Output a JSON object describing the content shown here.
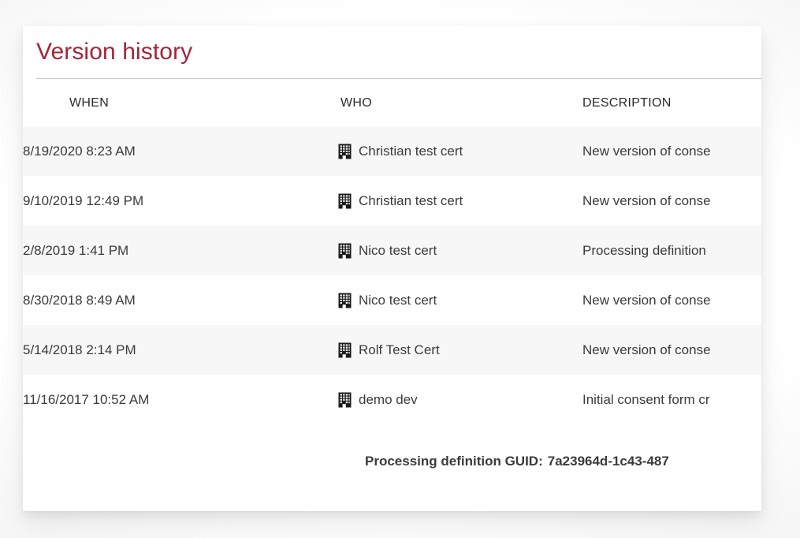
{
  "card": {
    "title": "Version history"
  },
  "table": {
    "columns": [
      {
        "key": "when",
        "label": "WHEN"
      },
      {
        "key": "who",
        "label": "WHO"
      },
      {
        "key": "description",
        "label": "DESCRIPTION"
      }
    ],
    "rows": [
      {
        "when": "8/19/2020 8:23 AM",
        "who": "Christian test cert",
        "who_icon": "building-icon",
        "description": "New version of conse"
      },
      {
        "when": "9/10/2019 12:49 PM",
        "who": "Christian test cert",
        "who_icon": "building-icon",
        "description": "New version of conse"
      },
      {
        "when": "2/8/2019 1:41 PM",
        "who": "Nico test cert",
        "who_icon": "building-icon",
        "description": "Processing definition"
      },
      {
        "when": "8/30/2018 8:49 AM",
        "who": "Nico test cert",
        "who_icon": "building-icon",
        "description": "New version of conse"
      },
      {
        "when": "5/14/2018 2:14 PM",
        "who": "Rolf Test Cert",
        "who_icon": "building-icon",
        "description": "New version of conse"
      },
      {
        "when": "11/16/2017 10:52 AM",
        "who": "demo dev",
        "who_icon": "building-icon",
        "description": "Initial consent form cr"
      }
    ]
  },
  "footer": {
    "guid_label": "Processing definition GUID:",
    "guid_value": "7a23964d-1c43-487"
  },
  "colors": {
    "title": "#a32638",
    "row_stripe": "#f7f7f7",
    "text": "#3b3b3b",
    "rule": "#c9c9c9"
  }
}
